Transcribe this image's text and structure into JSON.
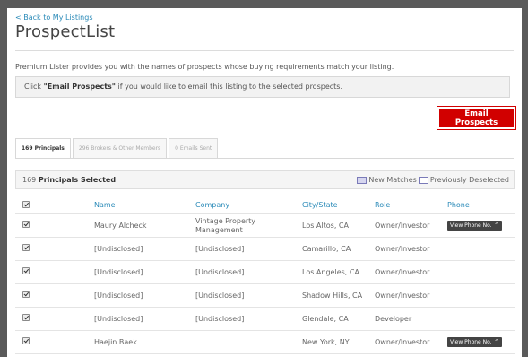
{
  "nav": {
    "back_label": "< Back to My Listings"
  },
  "page": {
    "title": "ProspectList",
    "description": "Premium Lister provides you with the names of prospects whose buying requirements match your listing.",
    "notice_prefix": "Click ",
    "notice_bold": "\"Email Prospects\"",
    "notice_suffix": " if you would like to email this listing to the selected prospects.",
    "email_button": "Email Prospects"
  },
  "tabs": [
    {
      "label": "169 Principals",
      "active": true
    },
    {
      "label": "296 Brokers & Other Members",
      "active": false
    },
    {
      "label": "0 Emails Sent",
      "active": false
    }
  ],
  "selection": {
    "count": "169",
    "label": "Principals Selected",
    "legend_new": "New Matches",
    "legend_prev": "Previously Deselected"
  },
  "table": {
    "columns": [
      "Name",
      "Company",
      "City/State",
      "Role",
      "Phone"
    ],
    "rows": [
      {
        "name": "Maury Alcheck",
        "company": "Vintage Property Management",
        "city": "Los Altos, CA",
        "role": "Owner/Investor",
        "phone": "View Phone No."
      },
      {
        "name": "[Undisclosed]",
        "company": "[Undisclosed]",
        "city": "Camarillo, CA",
        "role": "Owner/Investor",
        "phone": ""
      },
      {
        "name": "[Undisclosed]",
        "company": "[Undisclosed]",
        "city": "Los Angeles, CA",
        "role": "Owner/Investor",
        "phone": ""
      },
      {
        "name": "[Undisclosed]",
        "company": "[Undisclosed]",
        "city": "Shadow Hills, CA",
        "role": "Owner/Investor",
        "phone": ""
      },
      {
        "name": "[Undisclosed]",
        "company": "[Undisclosed]",
        "city": "Glendale, CA",
        "role": "Developer",
        "phone": ""
      },
      {
        "name": "Haejin Baek",
        "company": "",
        "city": "New York, NY",
        "role": "Owner/Investor",
        "phone": "View Phone No."
      }
    ]
  },
  "colors": {
    "accent": "#d10000",
    "link": "#2a8ab8",
    "phone_button": "#444444"
  }
}
